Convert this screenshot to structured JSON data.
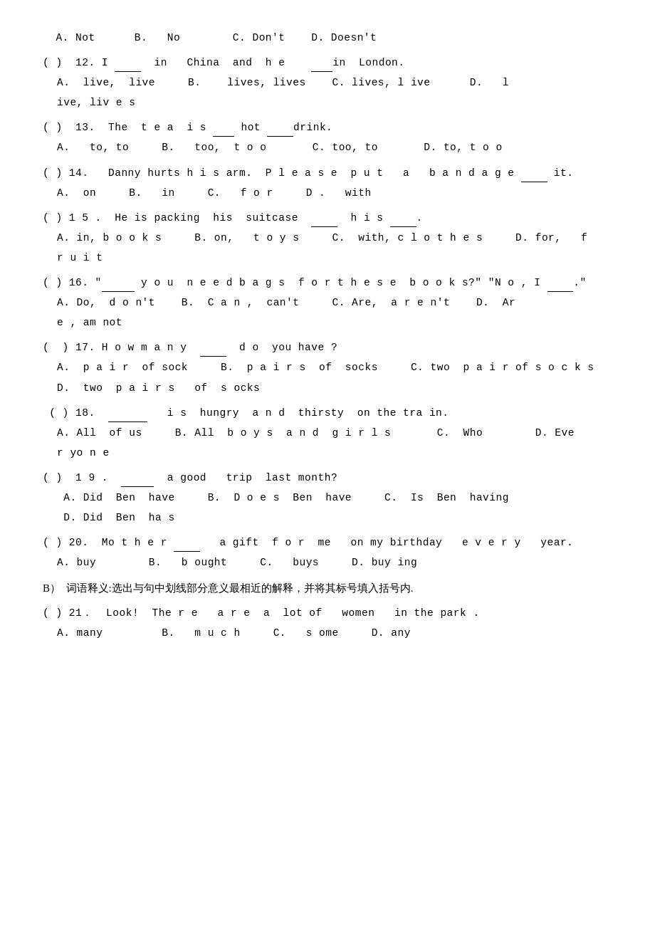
{
  "questions": [
    {
      "id": "q11_options",
      "line1": "  A. Not      B.  No       C. Don't   D. Doesn't"
    },
    {
      "id": "q12",
      "line1": "( )  12. I ____  in  China  and  h e   ___ in  London.",
      "line2": "  A.  live,  live    B.   lives, lives   C. lives, l ive    D.  l",
      "line3": "ive, liv e s"
    },
    {
      "id": "q13",
      "line1": "( )  13.  The  t e a  i s ___ hot ____  drink.",
      "line2": "  A.   to, to     B.  too,  t o o     C. too, to     D. to, t o o"
    },
    {
      "id": "q14",
      "line1": "( ) 14.   Danny hurts h i s arm.  P l e a s e  p u t   a   b a n d a g e ____ it.",
      "line2": "  A.  on     B.  in    C.  f o r    D .  with"
    },
    {
      "id": "q15",
      "line1": "( ) 1 5 .  He is packing  his  suitcase  ____  h i s ____ .",
      "line2": "  A. in, b o o k s    B. on,   t o y s    C.  with, c l o t h e s    D. for,  f",
      "line3": "r u i t"
    },
    {
      "id": "q16",
      "line1": "( ) 16. \"______ y o u  n e e d b a g s  f o r t h e s e  b o o k s ?\" \"N o , I ____ .\"",
      "line2": "  A. Do,  d o n't   B.  C a n ,  can't    C. Are,  a r e n't   D.  Ar",
      "line3": "e , am not"
    },
    {
      "id": "q17",
      "line1": "( ) 17. H o w m a n y  ____  d o  you have ?",
      "line2": "  A.  p a i r  of sock    B.  p a i r s  of  socks    C. two  p a i r of s o c k s",
      "line3": "  D.  two  p a i r s   of  s ocks"
    },
    {
      "id": "q18",
      "line1": " ( ) 18.  ______   i s  hungry  a n d  thirsty  on the tra in.",
      "line2": "  A. All  of us    B. All  b o y s  a n d  g i r l s     C.  Who      D. Eve",
      "line3": "r yo n e"
    },
    {
      "id": "q19",
      "line1": "( )  1 9 .  __ __  a good   trip  last month?",
      "line2": "  A. Did  Ben  have    B.  D o e s  Ben  have    C.  Is  Ben  having",
      "line3": "  D. Did  Ben  ha s"
    },
    {
      "id": "q20",
      "line1": "( ) 20.  Mo t h e r ____   a gift  f o r  me   on my birthday   e v e r y   year.",
      "line2": "  A. buy       B.   b ought    C.   buys    D. buy ing"
    },
    {
      "id": "section_b",
      "line1": "B）  词语释义:选出与句中划线部分意义最相近的解释，并将其标号填入括号内."
    },
    {
      "id": "q21",
      "line1": "( ) 21．  Look!  The r e   a r e  a  lot of   women   in the park .",
      "line2": "  A. many       B.   m u c h    C.   s ome    D. any"
    }
  ]
}
